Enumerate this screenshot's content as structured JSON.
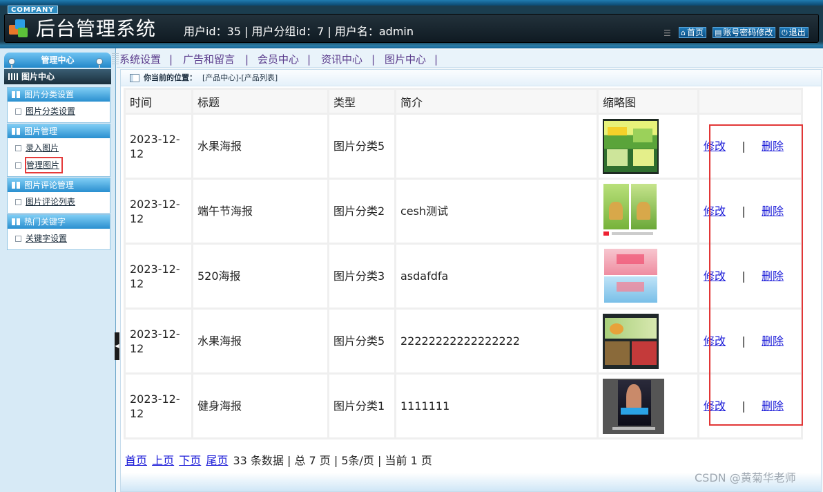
{
  "header": {
    "company": "COMPANY",
    "title": "后台管理系统",
    "user_info": "用户id：35 | 用户分组id：7 | 用户名：admin",
    "buttons": {
      "home": "首页",
      "change_password": "账号密码修改",
      "logout": "退出"
    }
  },
  "sidebar": {
    "title": "管理中心",
    "current": "图片中心",
    "sections": [
      {
        "title": "图片分类设置",
        "items": [
          "图片分类设置"
        ]
      },
      {
        "title": "图片管理",
        "items": [
          "录入图片",
          "管理图片"
        ]
      },
      {
        "title": "图片评论管理",
        "items": [
          "图片评论列表"
        ]
      },
      {
        "title": "热门关键字",
        "items": [
          "关键字设置"
        ]
      }
    ]
  },
  "topnav": [
    "系统设置",
    "广告和留言",
    "会员中心",
    "资讯中心",
    "图片中心"
  ],
  "location": {
    "label": "你当前的位置：",
    "path": "[产品中心]-[产品列表]"
  },
  "table": {
    "headers": [
      "时间",
      "标题",
      "类型",
      "简介",
      "缩略图",
      ""
    ],
    "rows": [
      {
        "time": "2023-12-12",
        "title": "水果海报",
        "type": "图片分类5",
        "intro": "",
        "thumb": "fruit-poster-thumbnail"
      },
      {
        "time": "2023-12-12",
        "title": "端午节海报",
        "type": "图片分类2",
        "intro": "cesh测试",
        "thumb": "dragon-boat-poster-thumbnail"
      },
      {
        "time": "2023-12-12",
        "title": "520海报",
        "type": "图片分类3",
        "intro": "asdafdfa",
        "thumb": "520-poster-thumbnail"
      },
      {
        "time": "2023-12-12",
        "title": "水果海报",
        "type": "图片分类5",
        "intro": "22222222222222222",
        "thumb": "fruit-poster-thumbnail"
      },
      {
        "time": "2023-12-12",
        "title": "健身海报",
        "type": "图片分类1",
        "intro": "1111111",
        "thumb": "fitness-poster-thumbnail"
      }
    ],
    "edit_label": "修改",
    "delete_label": "删除",
    "separator": "|"
  },
  "pager": {
    "first": "首页",
    "prev": "上页",
    "next": "下页",
    "last": "尾页",
    "summary": "33 条数据 | 总 7 页 | 5条/页 | 当前 1 页"
  },
  "watermark": "CSDN @黄菊华老师",
  "colors": {
    "highlight": "#e23636",
    "link": "#1a1ad8",
    "nav": "#5a3b8c"
  }
}
